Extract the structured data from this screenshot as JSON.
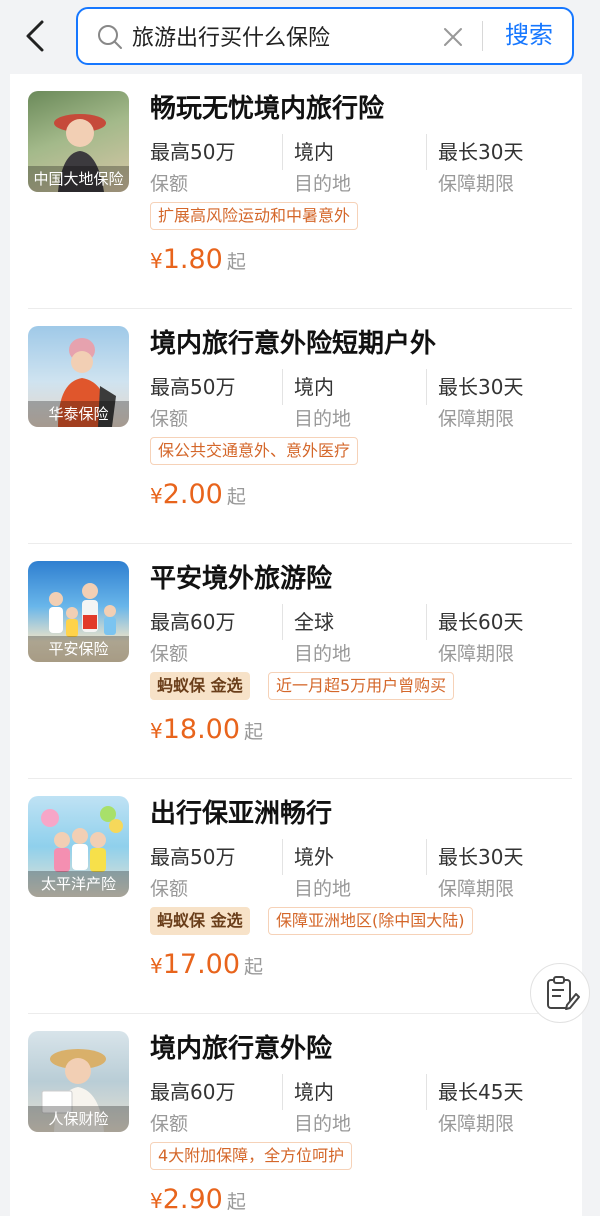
{
  "search": {
    "query": "旅游出行买什么保险",
    "button_label": "搜索"
  },
  "products": [
    {
      "title": "畅玩无忧境内旅行险",
      "insurer": "中国大地保险",
      "coverage_value": "最高50万",
      "coverage_label": "保额",
      "destination_value": "境内",
      "destination_label": "目的地",
      "period_value": "最长30天",
      "period_label": "保障期限",
      "badge": "",
      "tag": "扩展高风险运动和中暑意外",
      "currency": "¥",
      "price": "1.80",
      "price_suffix": "起"
    },
    {
      "title": "境内旅行意外险短期户外",
      "insurer": "华泰保险",
      "coverage_value": "最高50万",
      "coverage_label": "保额",
      "destination_value": "境内",
      "destination_label": "目的地",
      "period_value": "最长30天",
      "period_label": "保障期限",
      "badge": "",
      "tag": "保公共交通意外、意外医疗",
      "currency": "¥",
      "price": "2.00",
      "price_suffix": "起"
    },
    {
      "title": "平安境外旅游险",
      "insurer": "平安保险",
      "coverage_value": "最高60万",
      "coverage_label": "保额",
      "destination_value": "全球",
      "destination_label": "目的地",
      "period_value": "最长60天",
      "period_label": "保障期限",
      "badge": "蚂蚁保 金选",
      "tag": "近一月超5万用户曾购买",
      "currency": "¥",
      "price": "18.00",
      "price_suffix": "起"
    },
    {
      "title": "出行保亚洲畅行",
      "insurer": "太平洋产险",
      "coverage_value": "最高50万",
      "coverage_label": "保额",
      "destination_value": "境外",
      "destination_label": "目的地",
      "period_value": "最长30天",
      "period_label": "保障期限",
      "badge": "蚂蚁保 金选",
      "tag": "保障亚洲地区(除中国大陆)",
      "currency": "¥",
      "price": "17.00",
      "price_suffix": "起"
    },
    {
      "title": "境内旅行意外险",
      "insurer": "人保财险",
      "coverage_value": "最高60万",
      "coverage_label": "保额",
      "destination_value": "境内",
      "destination_label": "目的地",
      "period_value": "最长45天",
      "period_label": "保障期限",
      "badge": "",
      "tag": "4大附加保障，全方位呵护",
      "currency": "¥",
      "price": "2.90",
      "price_suffix": "起"
    }
  ],
  "icons": {
    "back": "chevron-left-icon",
    "search": "search-icon",
    "clear": "close-icon",
    "float": "clipboard-edit-icon"
  },
  "colors": {
    "accent": "#1677ff",
    "price": "#e8641c",
    "tag_border": "#f6d2b8",
    "badge_bg": "#f7e2c8"
  }
}
